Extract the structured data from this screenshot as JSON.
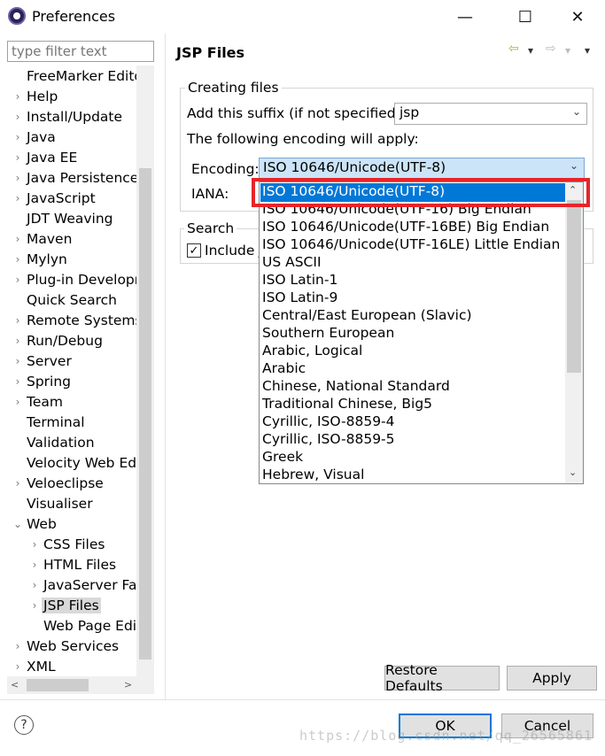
{
  "window": {
    "title": "Preferences",
    "minimize": "—",
    "maximize": "☐",
    "close": "✕"
  },
  "filter": {
    "placeholder": "type filter text"
  },
  "tree": [
    {
      "label": "FreeMarker Edito",
      "twisty": ""
    },
    {
      "label": "Help",
      "twisty": "›"
    },
    {
      "label": "Install/Update",
      "twisty": "›"
    },
    {
      "label": "Java",
      "twisty": "›"
    },
    {
      "label": "Java EE",
      "twisty": "›"
    },
    {
      "label": "Java Persistence",
      "twisty": "›"
    },
    {
      "label": "JavaScript",
      "twisty": "›"
    },
    {
      "label": "JDT Weaving",
      "twisty": ""
    },
    {
      "label": "Maven",
      "twisty": "›"
    },
    {
      "label": "Mylyn",
      "twisty": "›"
    },
    {
      "label": "Plug-in Developr",
      "twisty": "›"
    },
    {
      "label": "Quick Search",
      "twisty": ""
    },
    {
      "label": "Remote Systems",
      "twisty": "›"
    },
    {
      "label": "Run/Debug",
      "twisty": "›"
    },
    {
      "label": "Server",
      "twisty": "›"
    },
    {
      "label": "Spring",
      "twisty": "›"
    },
    {
      "label": "Team",
      "twisty": "›"
    },
    {
      "label": "Terminal",
      "twisty": ""
    },
    {
      "label": "Validation",
      "twisty": ""
    },
    {
      "label": "Velocity Web Edi",
      "twisty": ""
    },
    {
      "label": "Veloeclipse",
      "twisty": "›"
    },
    {
      "label": "Visualiser",
      "twisty": ""
    },
    {
      "label": "Web",
      "twisty": "⌄"
    },
    {
      "label": "CSS Files",
      "twisty": "›",
      "indent": 1
    },
    {
      "label": "HTML Files",
      "twisty": "›",
      "indent": 1
    },
    {
      "label": "JavaServer Fac",
      "twisty": "›",
      "indent": 1
    },
    {
      "label": "JSP Files",
      "twisty": "›",
      "indent": 1,
      "selected": true
    },
    {
      "label": "Web Page Edit",
      "twisty": "",
      "indent": 1
    },
    {
      "label": "Web Services",
      "twisty": "›"
    },
    {
      "label": "XML",
      "twisty": "›"
    }
  ],
  "page": {
    "title": "JSP Files",
    "nav_back": "⇦",
    "nav_fwd": "⇨",
    "nav_menu": "▾"
  },
  "creating_files": {
    "group_title": "Creating files",
    "suffix_label": "Add this suffix (if not specified):",
    "suffix_value": "jsp",
    "encoding_note": "The following encoding will apply:",
    "encoding_label": "Encoding:",
    "encoding_value": "ISO 10646/Unicode(UTF-8)",
    "iana_label": "IANA:"
  },
  "encoding_options": [
    "ISO 10646/Unicode(UTF-8)",
    "ISO 10646/Unicode(UTF-16) Big Endian",
    "ISO 10646/Unicode(UTF-16BE) Big Endian",
    "ISO 10646/Unicode(UTF-16LE) Little Endian",
    "US ASCII",
    "ISO Latin-1",
    "ISO Latin-9",
    "Central/East European (Slavic)",
    "Southern European",
    "Arabic, Logical",
    "Arabic",
    "Chinese, National Standard",
    "Traditional Chinese, Big5",
    "Cyrillic, ISO-8859-4",
    "Cyrillic, ISO-8859-5",
    "Greek",
    "Hebrew, Visual"
  ],
  "search": {
    "group_title": "Search",
    "include_label": "Include J",
    "checked": true
  },
  "buttons": {
    "restore_defaults": "Restore Defaults",
    "apply": "Apply",
    "ok": "OK",
    "cancel": "Cancel"
  },
  "help": "?",
  "watermark": "https://blog.csdn.net/qq_26565861",
  "colors": {
    "selection": "#0078d7",
    "highlight_box": "#e5252a",
    "combo_focus": "#cce4f7"
  }
}
